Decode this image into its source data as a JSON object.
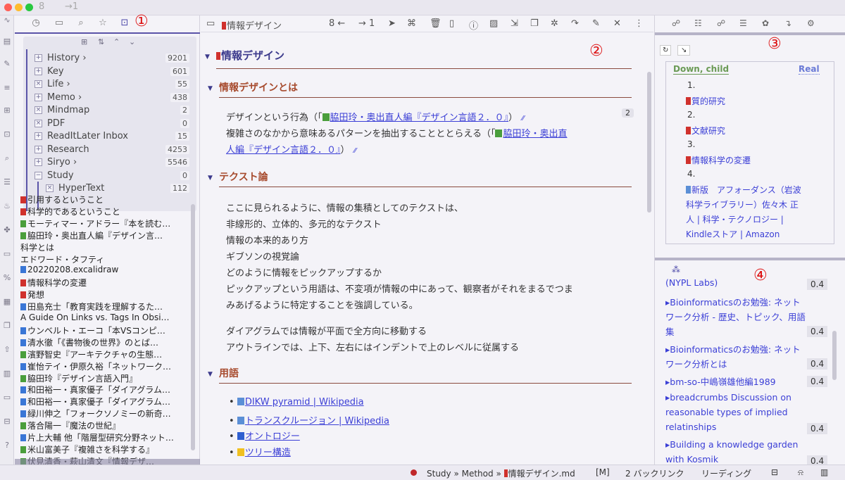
{
  "titlebar": {
    "nav_back": "8",
    "nav_fwd": "→1",
    "colors": {
      "close": "#ff5f57",
      "minimize": "#febc2e",
      "zoom": "#28c840"
    }
  },
  "annotations": [
    "①",
    "②",
    "③",
    "④"
  ],
  "left_toolbar_icons": [
    "clock-icon",
    "folder-icon",
    "search-icon",
    "star-icon",
    "inbox-icon"
  ],
  "tag_pane": {
    "tools": [
      "new-folder-icon",
      "sort-icon",
      "collapse-icon",
      "expand-icon"
    ],
    "tags": [
      {
        "name": "History ›",
        "count": "9201",
        "box": "+"
      },
      {
        "name": "Key",
        "count": "601",
        "box": "+"
      },
      {
        "name": "Life ›",
        "count": "55",
        "box": "×"
      },
      {
        "name": "Memo ›",
        "count": "438",
        "box": "+"
      },
      {
        "name": "Mindmap",
        "count": "2",
        "box": "×"
      },
      {
        "name": "PDF",
        "count": "0",
        "box": "×"
      },
      {
        "name": "ReadItLater Inbox",
        "count": "15",
        "box": "+"
      },
      {
        "name": "Research",
        "count": "4253",
        "box": "+"
      },
      {
        "name": "Siryo ›",
        "count": "5546",
        "box": "+"
      },
      {
        "name": "Study",
        "count": "0",
        "box": "−"
      },
      {
        "name": "HyperText",
        "count": "112",
        "box": "×"
      }
    ]
  },
  "file_list": [
    {
      "name": "引用するということ",
      "mark": "#d0312d"
    },
    {
      "name": "科学的であるということ",
      "mark": "#d0312d"
    },
    {
      "name": "モーティマー・アドラー『本を読む…",
      "mark": "#4a9e3c"
    },
    {
      "name": "脇田玲・奥出直人編『デザイン言…",
      "mark": "#4a9e3c"
    },
    {
      "name": "科学とは",
      "mark": ""
    },
    {
      "name": "エドワード・タフティ",
      "mark": ""
    },
    {
      "name": "20220208.excalidraw",
      "mark": "#3a76d6"
    },
    {
      "name": "情報科学の変遷",
      "mark": "#d0312d"
    },
    {
      "name": "発想",
      "mark": "#d0312d"
    },
    {
      "name": "田島充士「教育実践を理解するた…",
      "mark": "#3a76d6"
    },
    {
      "name": "A Guide On Links vs. Tags In Obsi…",
      "mark": ""
    },
    {
      "name": "ウンベルト・エーコ「本VSコンピ…",
      "mark": "#3a76d6"
    },
    {
      "name": "清水徹「《書物後の世界》のとば…",
      "mark": "#3a76d6"
    },
    {
      "name": "濱野智史『アーキテクチャの生態…",
      "mark": "#4a9e3c"
    },
    {
      "name": "崔怡テイ・伊原久裕「ネットワーク…",
      "mark": "#3a76d6"
    },
    {
      "name": "脇田玲『デザイン言語入門』",
      "mark": "#4a9e3c"
    },
    {
      "name": "和田裕一・真家優子「ダイアグラム…",
      "mark": "#3a76d6"
    },
    {
      "name": "和田裕一・真家優子「ダイアグラム…",
      "mark": "#3a76d6"
    },
    {
      "name": "緑川伸之「フォークソノミーの新奇…",
      "mark": "#3a76d6"
    },
    {
      "name": "落合陽一『魔法の世紀』",
      "mark": "#4a9e3c"
    },
    {
      "name": "片上大輔 他「階層型研究分野ネット…",
      "mark": "#3a76d6"
    },
    {
      "name": "米山富美子『複雑さを科学する』",
      "mark": "#4a9e3c"
    },
    {
      "name": "伏見清香・萩山清文『情報デザ…",
      "mark": "#4a9e3c"
    }
  ],
  "main": {
    "tab_title": "情報デザイン",
    "toolbar_nav": "8 ←",
    "toolbar_nav2": "→ 1",
    "h1": "情報デザイン",
    "sec1": {
      "title": "情報デザインとは",
      "line1_pre": "デザインという行為（「",
      "line1_link": "脇田玲・奥出直人編『デザイン言語２．０』",
      "line1_post": "）",
      "badge": "2",
      "line2_pre": "複雑さのなかから意味あるパターンを抽出することととらえる（「",
      "line2_link_a": "脇田玲・奥出直",
      "line2_link_b": "人編『デザイン言語２．０』",
      "line2_post": "）"
    },
    "sec2": {
      "title": "テクスト論",
      "lines": [
        "ここに見られるように、情報の集積としてのテクストは、",
        "非線形的、立体的、多元的なテクスト",
        "情報の本来的あり方",
        "ギブソンの視覚論",
        "どのように情報をピックアップするか",
        "ピックアップという用語は、不変項が情報の中にあって、観察者がそれをまるでつま",
        "みあげるように特定することを強調している。",
        "ダイアグラムでは情報が平面で全方向に移動する",
        "アウトラインでは、上下、左右にはインデントで上のレベルに従属する"
      ]
    },
    "sec3": {
      "title": "用語",
      "items": [
        {
          "text": "DIKW pyramid | Wikipedia",
          "mark": "#5b8fd6"
        },
        {
          "text": "トランスクルージョン | Wikipedia",
          "mark": "#5b8fd6"
        },
        {
          "text": "オントロジー",
          "mark": "#2f5fd0"
        },
        {
          "text": "ツリー構造",
          "mark": "#f0c020"
        }
      ]
    }
  },
  "right": {
    "top_icons": [
      "graph-icon",
      "list-icon",
      "graph2-icon",
      "list2-icon",
      "palette-icon",
      "arrow-icon",
      "flow-icon"
    ],
    "down_child": "Down, child",
    "real": "Real",
    "items": [
      {
        "num": "1.",
        "text": "質的研究",
        "mark": "#d0312d"
      },
      {
        "num": "2.",
        "text": "文献研究",
        "mark": "#d0312d"
      },
      {
        "num": "3.",
        "text": "情報科学の変遷",
        "mark": "#d0312d"
      },
      {
        "num": "4.",
        "text": "新版　アフォーダンス（岩波",
        "mark": "#5b8fd6"
      }
    ],
    "item4_cont": [
      "科学ライブラリー）佐々木 正",
      "人 | 科学・テクノロジー |",
      "Kindleストア | Amazon"
    ],
    "similar": [
      {
        "lines": [
          "(NYPL Labs)"
        ],
        "score": "0.4"
      },
      {
        "lines": [
          "▸Bioinformaticsのお勉強: ネット",
          "ワーク分析 - 歴史、トピック、用語",
          "集"
        ],
        "score": "0.4"
      },
      {
        "lines": [
          "▸Bioinformaticsのお勉強: ネット",
          "ワーク分析とは"
        ],
        "score": "0.4"
      },
      {
        "lines": [
          "▸bm-so-中嶋嶺雄他編1989"
        ],
        "score": "0.4"
      },
      {
        "lines": [
          "▸breadcrumbs Discussion on",
          "reasonable types of implied",
          "relatinships"
        ],
        "score": "0.4"
      },
      {
        "lines": [
          "▸Building a knowledge garden",
          "with Kosmik"
        ],
        "score": "0.4"
      }
    ]
  },
  "status": {
    "path": "Study » Method » 情報デザイン.md",
    "mode": "[M]",
    "backlinks": "2 バックリンク",
    "reading": "リーディング",
    "dot_color": "#c0282a"
  }
}
